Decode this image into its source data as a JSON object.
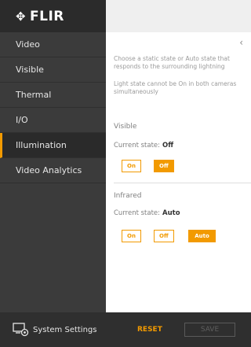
{
  "brand": {
    "name": "FLIR"
  },
  "sidebar": {
    "items": [
      {
        "label": "Video",
        "active": false
      },
      {
        "label": "Visible",
        "active": false
      },
      {
        "label": "Thermal",
        "active": false
      },
      {
        "label": "I/O",
        "active": false
      },
      {
        "label": "Illumination",
        "active": true
      },
      {
        "label": "Video Analytics",
        "active": false
      }
    ],
    "system_settings_label": "System Settings"
  },
  "content": {
    "description": "Choose a static state or Auto state that responds to the surrounding lightning",
    "note": "Light state cannot be On in both cameras simultaneously",
    "visible": {
      "label": "Visible",
      "state_label": "Current state:",
      "state_value": "Off",
      "buttons": [
        "On",
        "Off"
      ]
    },
    "infrared": {
      "label": "Infrared",
      "state_label": "Current state:",
      "state_value": "Auto",
      "buttons": [
        "On",
        "Off",
        "Auto"
      ]
    }
  },
  "footer": {
    "reset_label": "RESET",
    "save_label": "SAVE"
  },
  "colors": {
    "accent": "#f29a00",
    "sidebar": "#3b3b3b"
  },
  "icons": [
    "flir-logo-icon",
    "chevron-left-icon",
    "system-settings-icon"
  ]
}
